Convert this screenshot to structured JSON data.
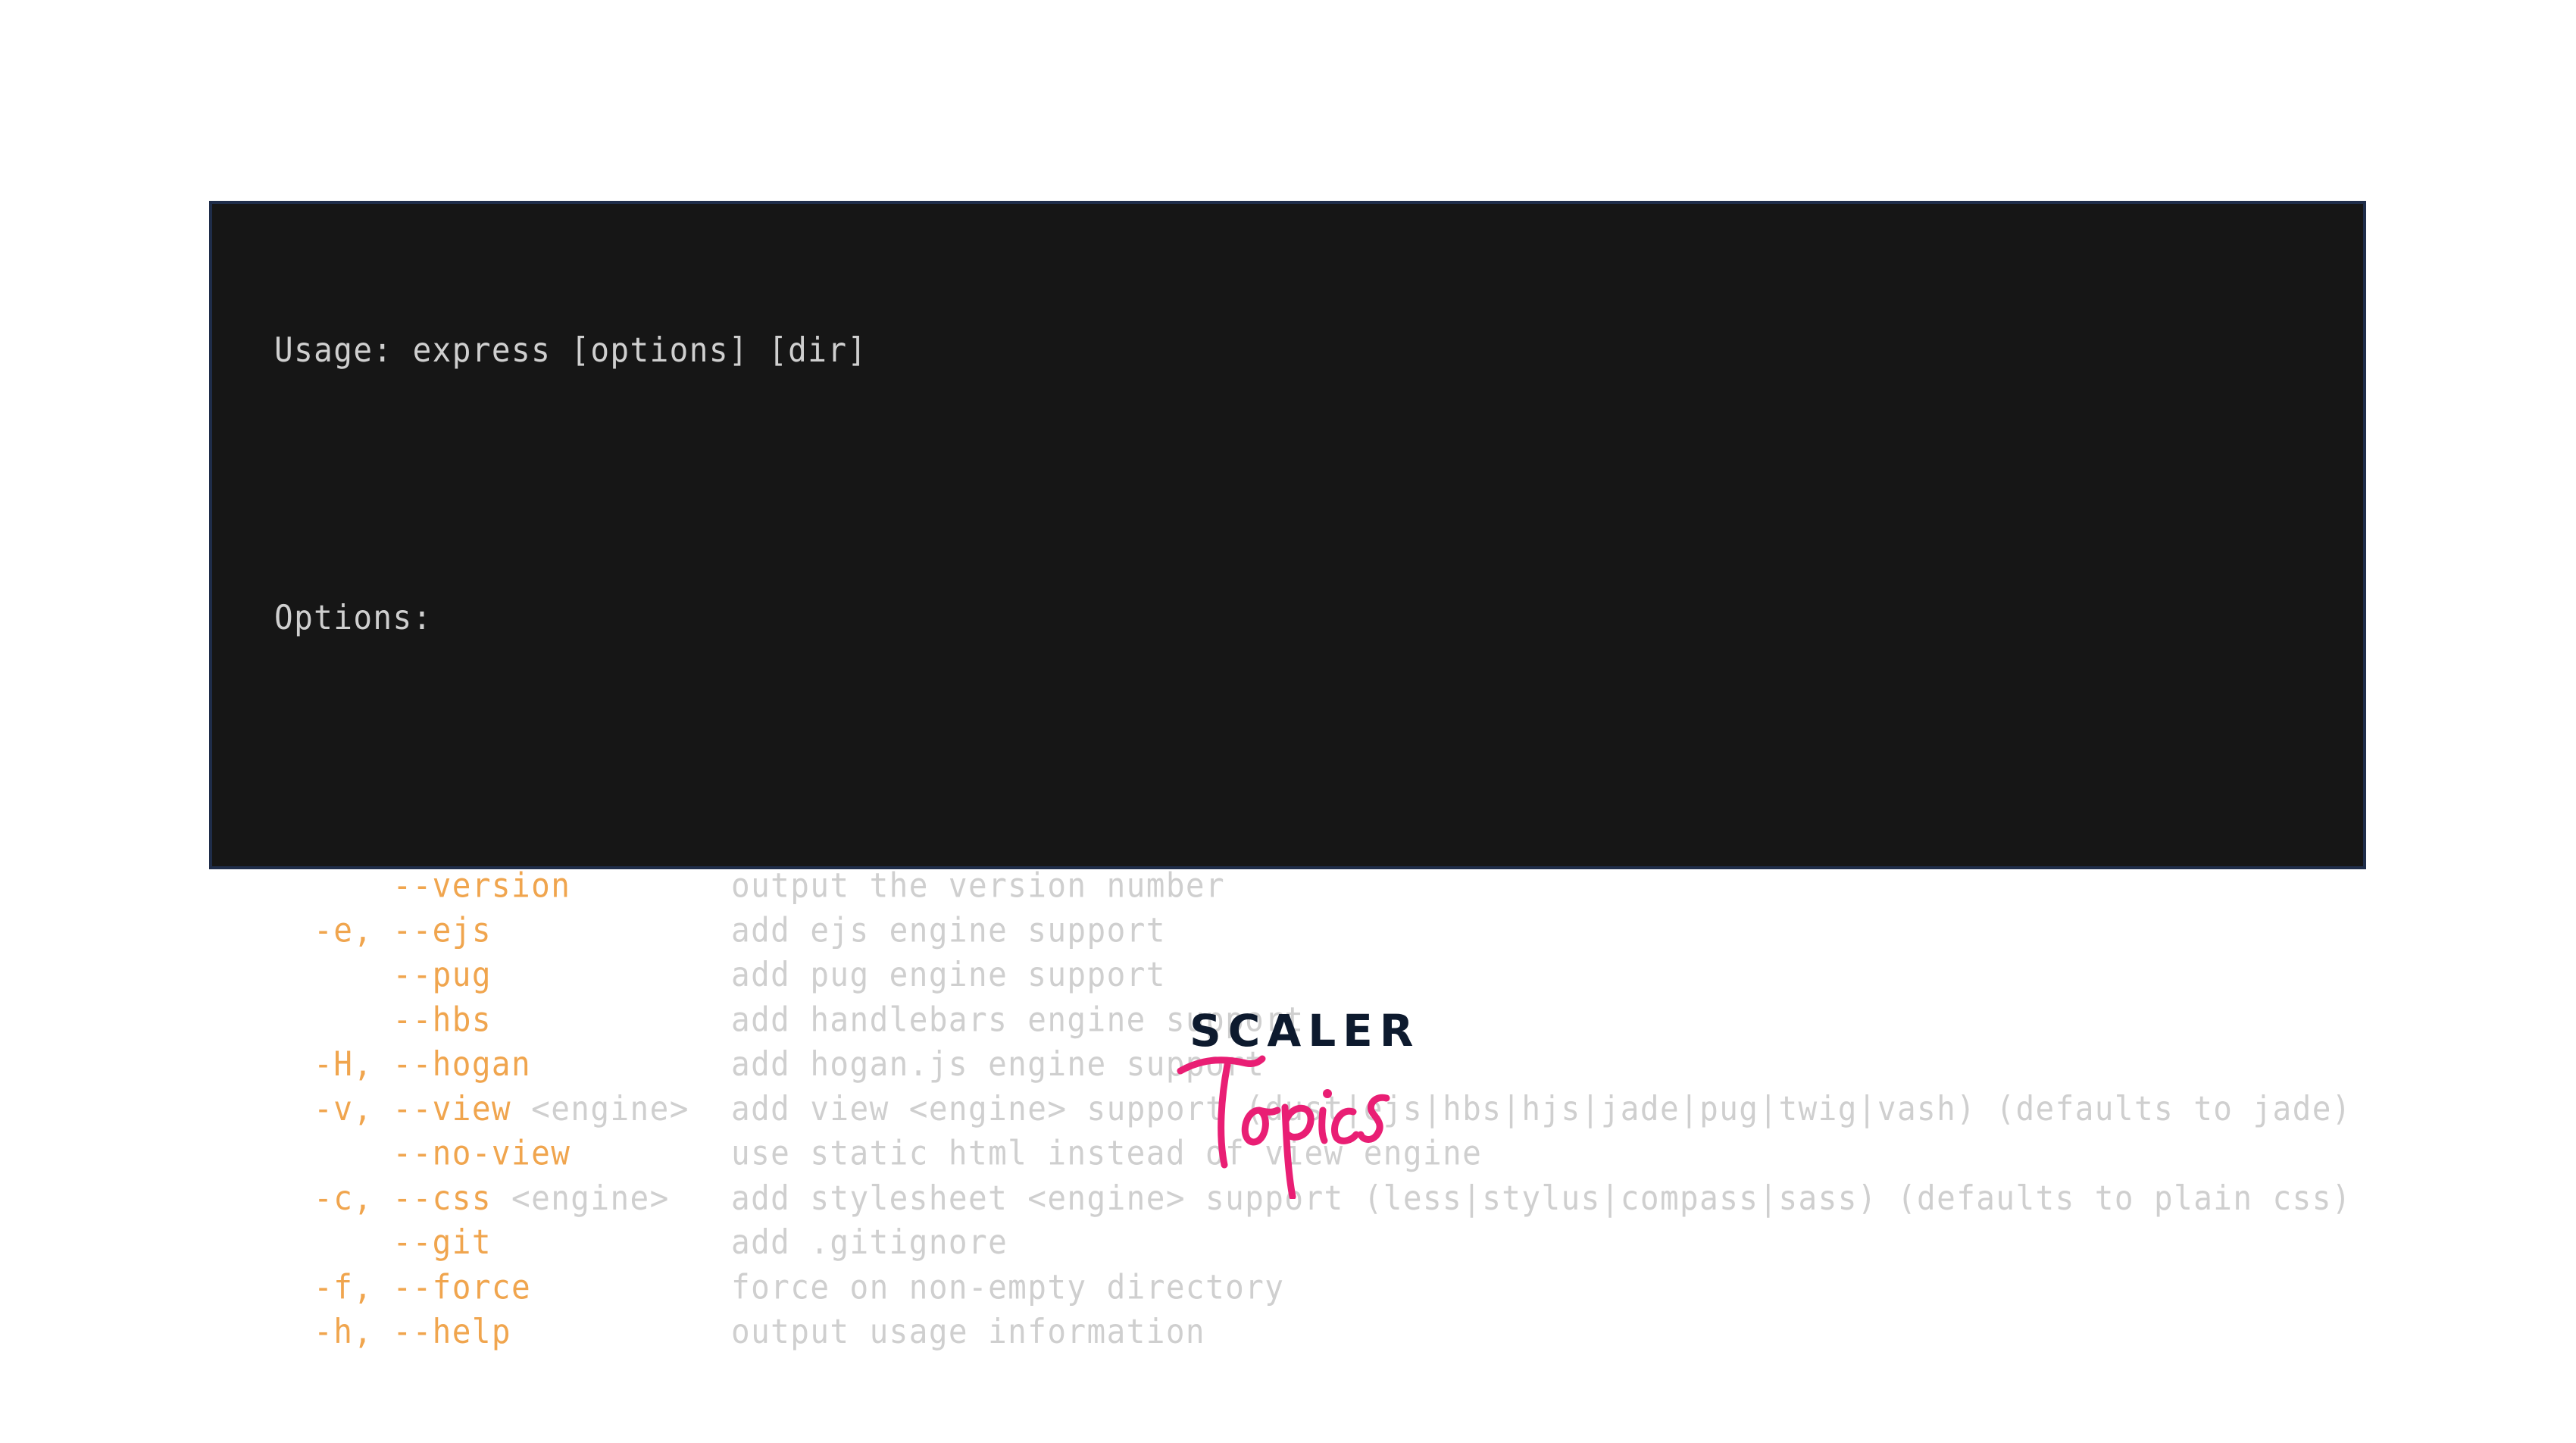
{
  "terminal": {
    "usage": "Usage: express [options] [dir]",
    "options_heading": "Options:",
    "options": [
      {
        "short": "",
        "long": "--version",
        "arg": "",
        "description": "output the version number"
      },
      {
        "short": "-e,",
        "long": "--ejs",
        "arg": "",
        "description": "add ejs engine support"
      },
      {
        "short": "",
        "long": "--pug",
        "arg": "",
        "description": "add pug engine support"
      },
      {
        "short": "",
        "long": "--hbs",
        "arg": "",
        "description": "add handlebars engine support"
      },
      {
        "short": "-H,",
        "long": "--hogan",
        "arg": "",
        "description": "add hogan.js engine support"
      },
      {
        "short": "-v,",
        "long": "--view",
        "arg": "<engine>",
        "description": "add view <engine> support (dust|ejs|hbs|hjs|jade|pug|twig|vash) (defaults to jade)"
      },
      {
        "short": "",
        "long": "--no-view",
        "arg": "",
        "description": "use static html instead of view engine"
      },
      {
        "short": "-c,",
        "long": "--css",
        "arg": "<engine>",
        "description": "add stylesheet <engine> support (less|stylus|compass|sass) (defaults to plain css)"
      },
      {
        "short": "",
        "long": "--git",
        "arg": "",
        "description": "add .gitignore"
      },
      {
        "short": "-f,",
        "long": "--force",
        "arg": "",
        "description": "force on non-empty directory"
      },
      {
        "short": "-h,",
        "long": "--help",
        "arg": "",
        "description": "output usage information"
      }
    ],
    "colors": {
      "background": "#161616",
      "border": "#1f2d4a",
      "text": "#cfcfcf",
      "flag": "#f0a54e"
    }
  },
  "logo": {
    "brand": "SCALER",
    "product": "Topics",
    "colors": {
      "brand": "#0d1a2e",
      "product": "#e91e74"
    }
  }
}
